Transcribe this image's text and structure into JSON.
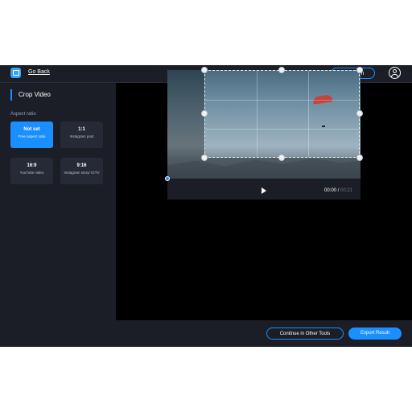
{
  "header": {
    "back_label": "Go Back",
    "premium_label": "Premium",
    "logo_icon": "app-logo-icon",
    "account_icon": "user-circle-icon"
  },
  "sidebar": {
    "title": "Crop Video",
    "aspect_label": "Aspect ratio",
    "options": [
      {
        "ratio": "Not set",
        "desc": "Free aspect ratio",
        "active": true
      },
      {
        "ratio": "1:1",
        "desc": "Instagram post",
        "active": false
      },
      {
        "ratio": "16:9",
        "desc": "YouTube video",
        "active": false
      },
      {
        "ratio": "9:16",
        "desc": "Instagram story/ IGTV",
        "active": false
      }
    ]
  },
  "player": {
    "current_time": "00:00",
    "separator": "/",
    "duration": "00:21",
    "progress": 0
  },
  "footer": {
    "continue_label": "Continue in Other Tools",
    "export_label": "Export Result"
  },
  "colors": {
    "accent": "#1a8fff",
    "panel": "#1b1e27",
    "canvas": "#000000"
  }
}
